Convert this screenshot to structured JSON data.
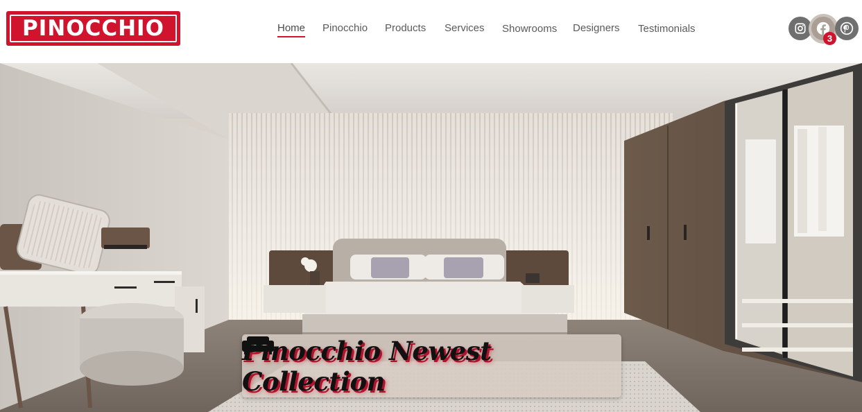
{
  "brand": {
    "logo_text": "PINOCCHIO",
    "primary_color": "#d0142d"
  },
  "nav": {
    "items": [
      {
        "label": "Home",
        "active": true
      },
      {
        "label": "Pinocchio",
        "active": false
      },
      {
        "label": "Products",
        "active": false
      },
      {
        "label": "Services",
        "active": false
      },
      {
        "label": "Showrooms",
        "active": false
      },
      {
        "label": "Designers",
        "active": false
      },
      {
        "label": "Testimonials",
        "active": false
      }
    ]
  },
  "social": {
    "icons": [
      "instagram-icon",
      "facebook-icon",
      "pinterest-icon"
    ],
    "notification_count": "3"
  },
  "hero": {
    "caption": "Pinocchio Newest Collection",
    "caption_icon": "sofa-icon"
  }
}
